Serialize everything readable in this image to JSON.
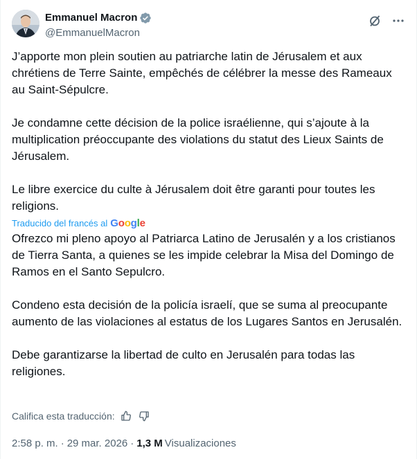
{
  "author": {
    "name": "Emmanuel Macron",
    "handle": "@EmmanuelMacron",
    "verified_color": "#829aab"
  },
  "icons": {
    "grok": "slashed-circle-icon",
    "more": "more-dots-icon",
    "like": "thumbs-up-icon",
    "dislike": "thumbs-down-icon"
  },
  "original_text": [
    "J’apporte mon plein soutien au patriarche latin de Jérusalem et aux chrétiens de Terre Sainte, empêchés de célébrer la messe des Rameaux au Saint-Sépulcre.",
    "Je condamne cette décision de la police israélienne, qui s’ajoute à la multiplication préoccupante des violations du statut des Lieux Saints de Jérusalem.",
    "Le libre exercice du culte à Jérusalem doit être garanti pour toutes les religions."
  ],
  "translation": {
    "label": "Traducido del francés al",
    "provider": [
      "G",
      "o",
      "o",
      "g",
      "l",
      "e"
    ],
    "provider_colors": [
      "#4285F4",
      "#EA4335",
      "#FBBC05",
      "#4285F4",
      "#34A853",
      "#EA4335"
    ],
    "paragraphs": [
      "Ofrezco mi pleno apoyo al Patriarca Latino de Jerusalén y a los cristianos de Tierra Santa, a quienes se les impide celebrar la Misa del Domingo de Ramos en el Santo Sepulcro.",
      "Condeno esta decisión de la policía israelí, que se suma al preocupante aumento de las violaciones al estatus de los Lugares Santos en Jerusalén.",
      "Debe garantizarse la libertad de culto en Jerusalén para todas las religiones."
    ],
    "rate_label": "Califica esta traducción:"
  },
  "meta": {
    "time": "2:58 p. m.",
    "separator": "·",
    "date": "29 mar. 2026",
    "views_count": "1,3 M",
    "views_label": "Visualizaciones"
  }
}
